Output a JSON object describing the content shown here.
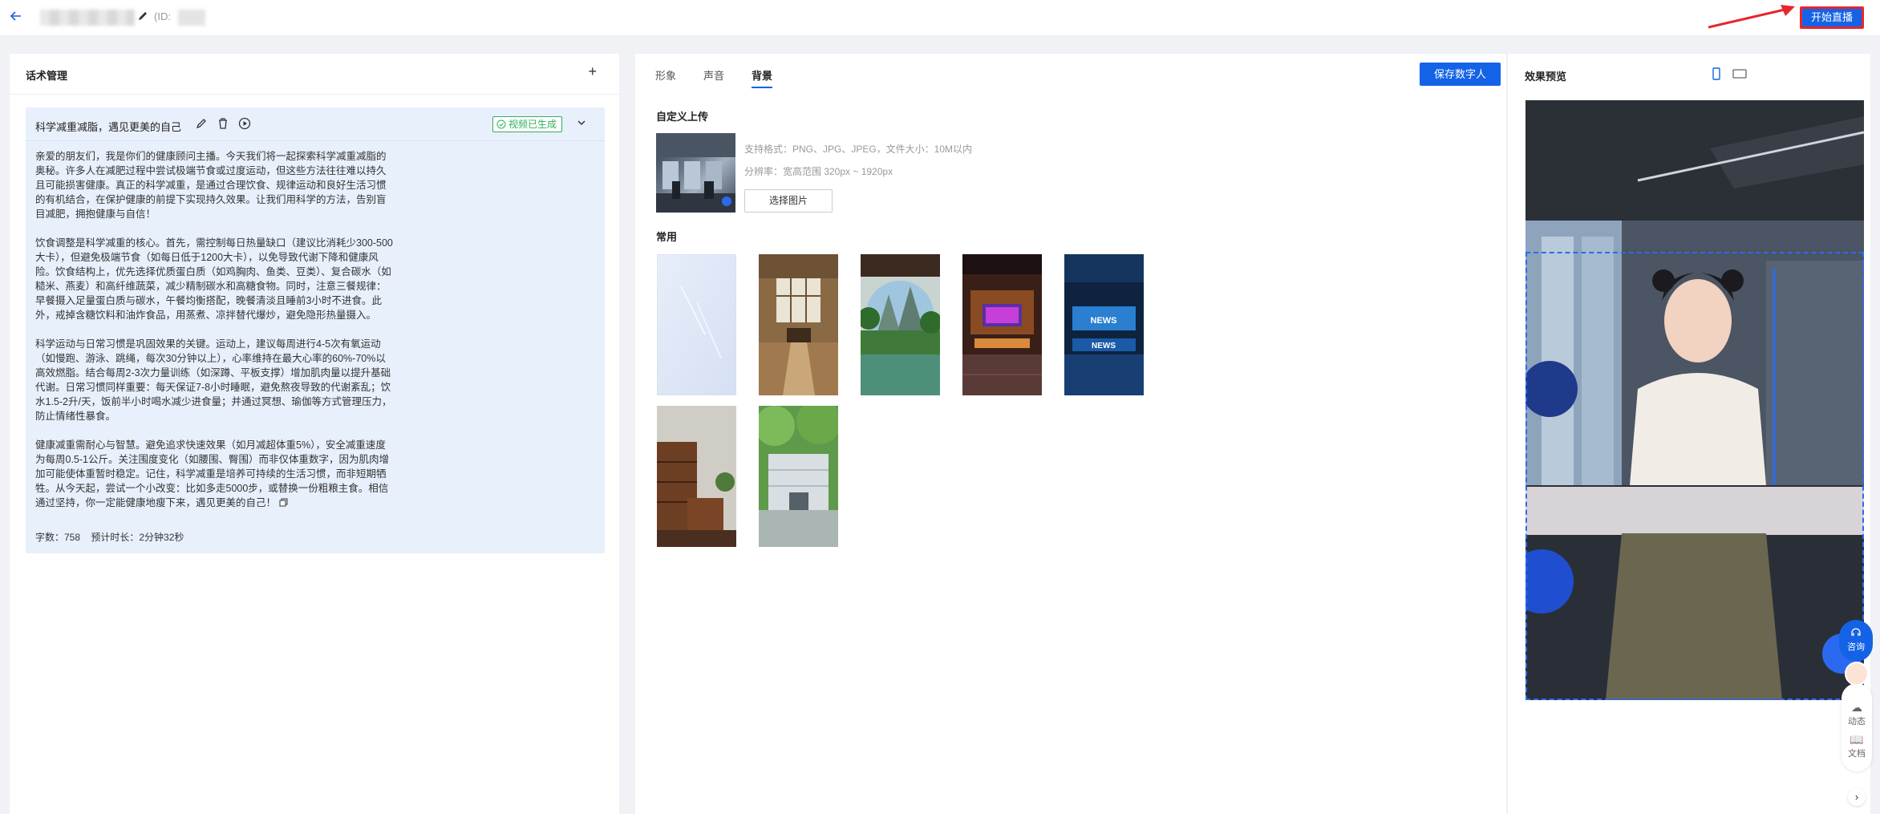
{
  "header": {
    "back_icon": "arrow-left-icon",
    "id_label": "(ID:",
    "start_live_label": "开始直播",
    "accent": "#1463e6",
    "highlight": "#e6262e"
  },
  "script_panel": {
    "title": "话术管理",
    "add_icon": "plus-icon",
    "card": {
      "title": "科学减重减脂，遇见更美的自己",
      "status": "视频已生成",
      "status_color": "#2fae5d",
      "paragraphs": [
        "亲爱的朋友们，我是你们的健康顾问主播。今天我们将一起探索科学减重减脂的奥秘。许多人在减肥过程中尝试极端节食或过度运动，但这些方法往往难以持久且可能损害健康。真正的科学减重，是通过合理饮食、规律运动和良好生活习惯的有机结合，在保护健康的前提下实现持久效果。让我们用科学的方法，告别盲目减肥，拥抱健康与自信！",
        "饮食调整是科学减重的核心。首先，需控制每日热量缺口（建议比消耗少300-500大卡），但避免极端节食（如每日低于1200大卡），以免导致代谢下降和健康风险。饮食结构上，优先选择优质蛋白质（如鸡胸肉、鱼类、豆类）、复合碳水（如糙米、燕麦）和高纤维蔬菜，减少精制碳水和高糖食物。同时，注意三餐规律：早餐摄入足量蛋白质与碳水，午餐均衡搭配，晚餐清淡且睡前3小时不进食。此外，戒掉含糖饮料和油炸食品，用蒸煮、凉拌替代爆炒，避免隐形热量摄入。",
        "科学运动与日常习惯是巩固效果的关键。运动上，建议每周进行4-5次有氧运动（如慢跑、游泳、跳绳，每次30分钟以上），心率维持在最大心率的60%-70%以高效燃脂。结合每周2-3次力量训练（如深蹲、平板支撑）增加肌肉量以提升基础代谢。日常习惯同样重要：每天保证7-8小时睡眠，避免熬夜导致的代谢紊乱；饮水1.5-2升/天，饭前半小时喝水减少进食量；并通过冥想、瑜伽等方式管理压力，防止情绪性暴食。",
        "健康减重需耐心与智慧。避免追求快速效果（如月减超体重5%），安全减重速度为每周0.5-1公斤。关注围度变化（如腰围、臀围）而非仅体重数字，因为肌肉增加可能使体重暂时稳定。记住，科学减重是培养可持续的生活习惯，而非短期牺牲。从今天起，尝试一个小改变：比如多走5000步，或替换一份粗粮主食。相信通过坚持，你一定能健康地瘦下来，遇见更美的自己！"
      ],
      "stats": {
        "word_count": "字数：758",
        "duration": "预计时长：2分钟32秒"
      }
    }
  },
  "middle": {
    "tabs": [
      "形象",
      "声音",
      "背景"
    ],
    "active_tab": 2,
    "save_label": "保存数字人",
    "upload": {
      "title": "自定义上传",
      "formats": "支持格式：PNG、JPG、JPEG，文件大小：10M以内",
      "resolution": "分辨率：宽高范围 320px ~ 1920px",
      "choose_label": "选择图片"
    },
    "common_title": "常用",
    "backgrounds": [
      {
        "name": "light-blue-texture"
      },
      {
        "name": "classic-hall"
      },
      {
        "name": "chinese-garden"
      },
      {
        "name": "neon-stage"
      },
      {
        "name": "news-studio"
      },
      {
        "name": "wooden-office"
      },
      {
        "name": "building-exterior"
      }
    ]
  },
  "preview": {
    "title": "效果预览",
    "portrait_icon": "phone-portrait-icon",
    "landscape_icon": "tablet-landscape-icon"
  },
  "side_tools": {
    "consult_label": "咨询",
    "dynamic_label": "动态",
    "docs_label": "文档"
  }
}
